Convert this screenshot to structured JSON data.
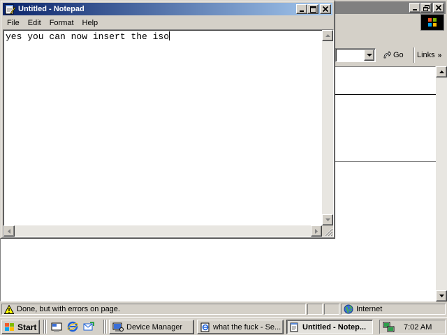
{
  "notepad": {
    "title": "Untitled - Notepad",
    "menu": [
      "File",
      "Edit",
      "Format",
      "Help"
    ],
    "text": "yes you can now insert the iso"
  },
  "browser": {
    "go_label": "Go",
    "links_label": "Links",
    "status_text": "Done, but with errors on page.",
    "zone_label": "Internet"
  },
  "taskbar": {
    "start_label": "Start",
    "buttons": [
      "Device Manager",
      "what the fuck - Se...",
      "Untitled - Notep..."
    ],
    "clock": "7:02 AM"
  },
  "icons": {
    "minimize": "minimize-icon",
    "maximize": "maximize-icon",
    "restore": "restore-icon",
    "close": "close-icon",
    "warning": "warning-icon",
    "globe": "globe-icon",
    "windows_flag": "windows-logo-icon"
  },
  "colors": {
    "title_active_start": "#0a246a",
    "title_active_end": "#a6caf0",
    "title_inactive": "#808080",
    "face": "#d4d0c8"
  }
}
